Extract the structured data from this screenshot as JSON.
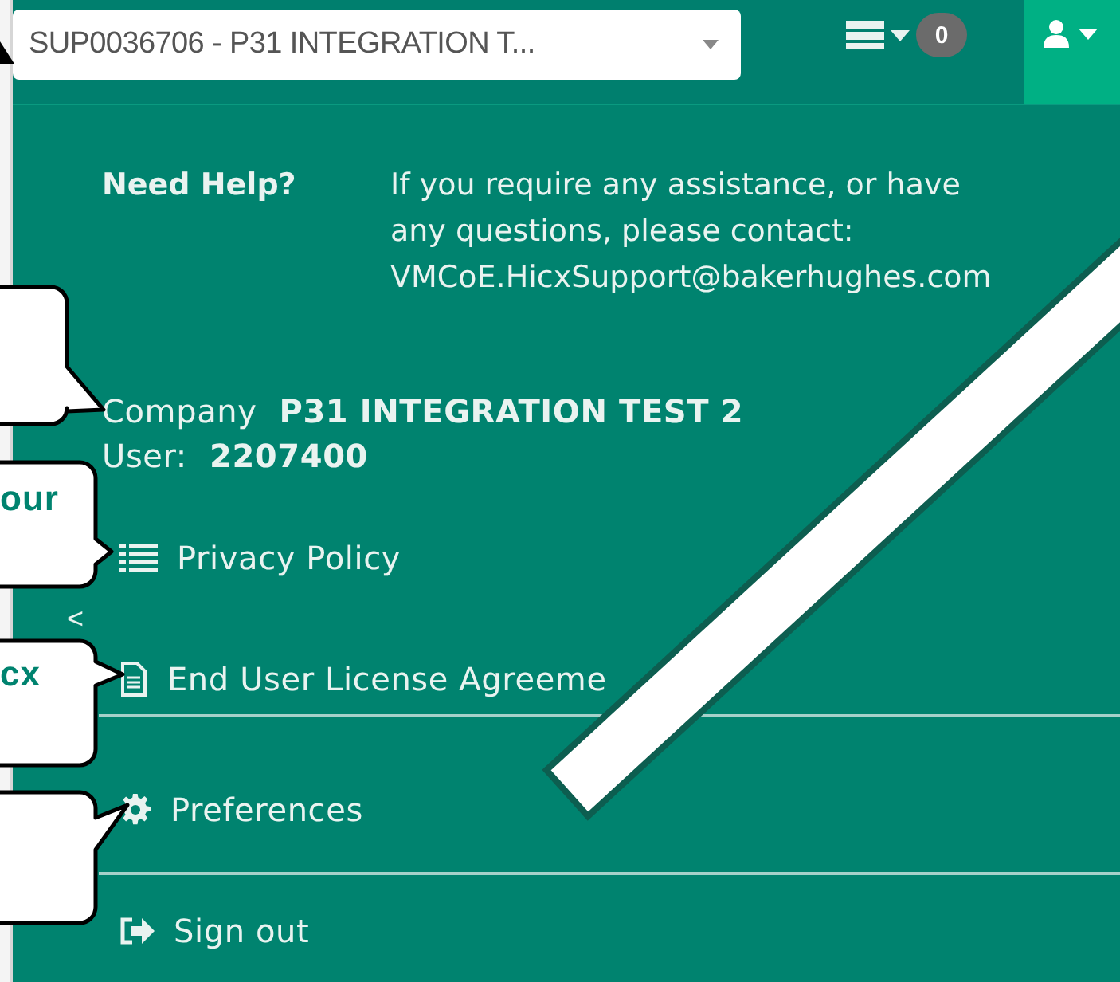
{
  "dropdown": {
    "value": "SUP0036706 - P31 INTEGRATION T..."
  },
  "notifications": {
    "count": "0"
  },
  "help": {
    "label": "Need Help?",
    "text": "If you require any assistance, or have any questions, please contact: VMCoE.HicxSupport@bakerhughes.com"
  },
  "company": {
    "label": "Company",
    "value": "P31 INTEGRATION TEST 2"
  },
  "user": {
    "label": "User:",
    "value": "2207400"
  },
  "collapse_toggle": "<",
  "menu": [
    {
      "kind": "privacy",
      "label": "Privacy Policy",
      "separated": false
    },
    {
      "kind": "license",
      "label": "End User License Agreeme",
      "separated": false
    },
    {
      "kind": "preferences",
      "label": "Preferences",
      "separated": true
    },
    {
      "kind": "signout",
      "label": "Sign out",
      "separated": true
    }
  ],
  "callouts": [
    {
      "kind": "blank"
    },
    {
      "kind": "text",
      "text": "our"
    },
    {
      "kind": "text",
      "text": "cx"
    },
    {
      "kind": "blank"
    }
  ]
}
